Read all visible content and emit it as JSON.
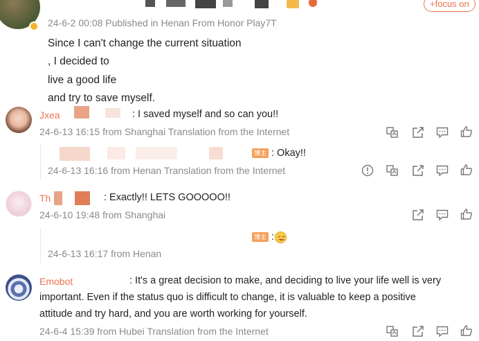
{
  "post": {
    "meta": "24-6-2 00:08 Published in Henan From Honor Play7T",
    "follow_label": "+focus on",
    "lines": [
      "Since I can't change the current situation",
      ", I decided to",
      "live a good life",
      "and try to save myself."
    ]
  },
  "comments": [
    {
      "name": "Jxea",
      "text": ": I saved myself and so can you!!",
      "meta": "24-6-13 16:15 from Shanghai Translation from the Internet"
    },
    {
      "badge": "博主",
      "text": ": Okay!!",
      "meta": "24-6-13 16:16 from Henan Translation from the Internet"
    },
    {
      "name": "Th",
      "text": ": Exactly!! LETS GOOOOO!!",
      "meta": "24-6-10 19:48 from Shanghai"
    },
    {
      "badge": "博主",
      "text": ":",
      "meta": "24-6-13 16:17 from Henan"
    },
    {
      "name": "Emobot",
      "text_lines": [
        ": It's a great decision to make, and deciding to live your life well is very",
        "important. Even if the status quo is difficult to change, it is valuable to keep a positive",
        "attitude and try hard, and you are worth working for yourself."
      ],
      "meta": "24-6-4 15:39 from Hubei Translation from the Internet"
    }
  ],
  "colors": {
    "accent": "#eb7350",
    "meta_gray": "#8a8a8a",
    "badge": "#f5a05a"
  }
}
